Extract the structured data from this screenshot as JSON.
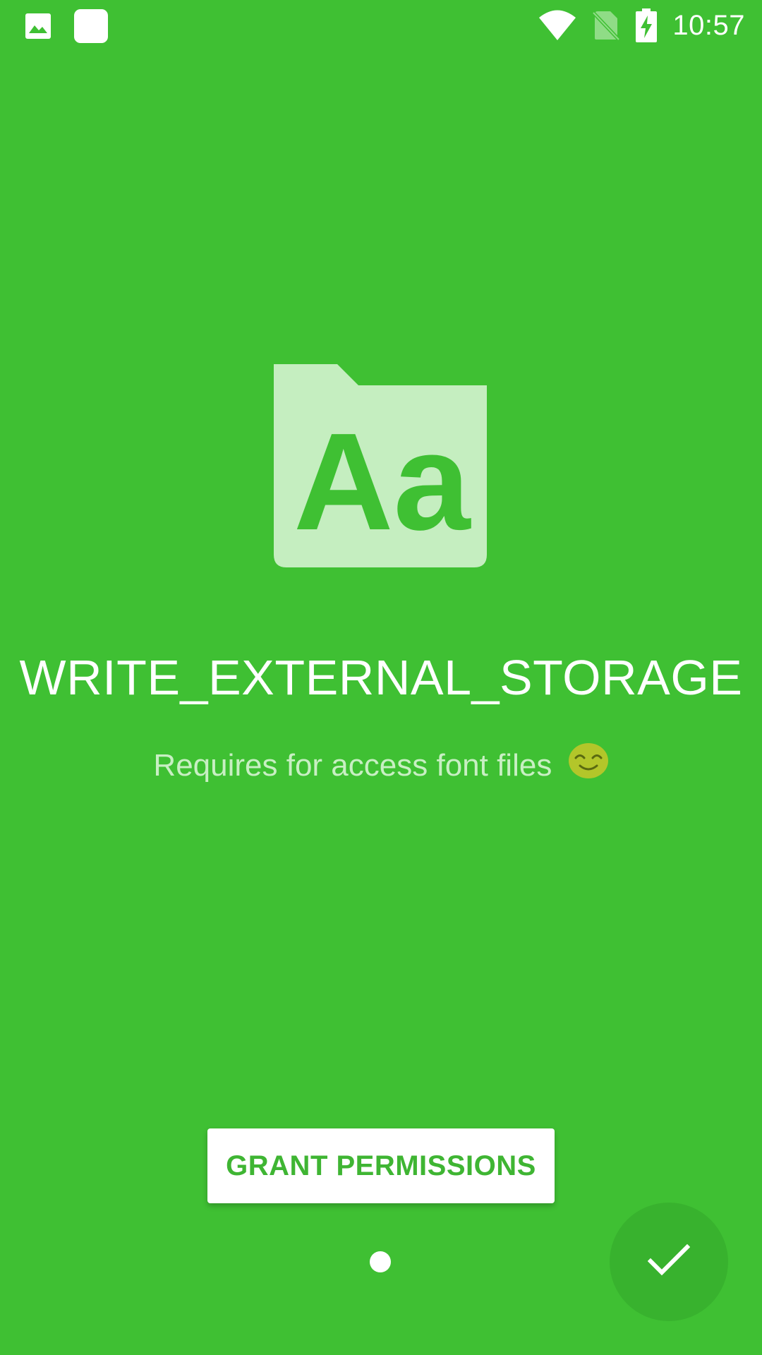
{
  "status_bar": {
    "time": "10:57",
    "left_icons": [
      "image-icon",
      "app-square-icon"
    ],
    "right_icons": [
      "wifi-icon",
      "no-sim-icon",
      "battery-charging-icon"
    ]
  },
  "intro": {
    "illustration_icon": "font-folder-icon",
    "illustration_letters": "Aa",
    "title": "WRITE_EXTERNAL_STORAGE",
    "subtitle": "Requires for access font files",
    "subtitle_emoji": "smiling-face-icon",
    "grant_button_label": "GRANT PERMISSIONS",
    "done_icon": "check-icon"
  },
  "pager": {
    "total_pages": 1,
    "current_page": 1
  },
  "colors": {
    "background": "#3fc033",
    "illustration_fill": "#c5eec0",
    "subtitle_text": "#c8efc3",
    "button_text": "#3fb533",
    "fab_background": "#38b22e",
    "emoji_face": "#b3c62a"
  }
}
